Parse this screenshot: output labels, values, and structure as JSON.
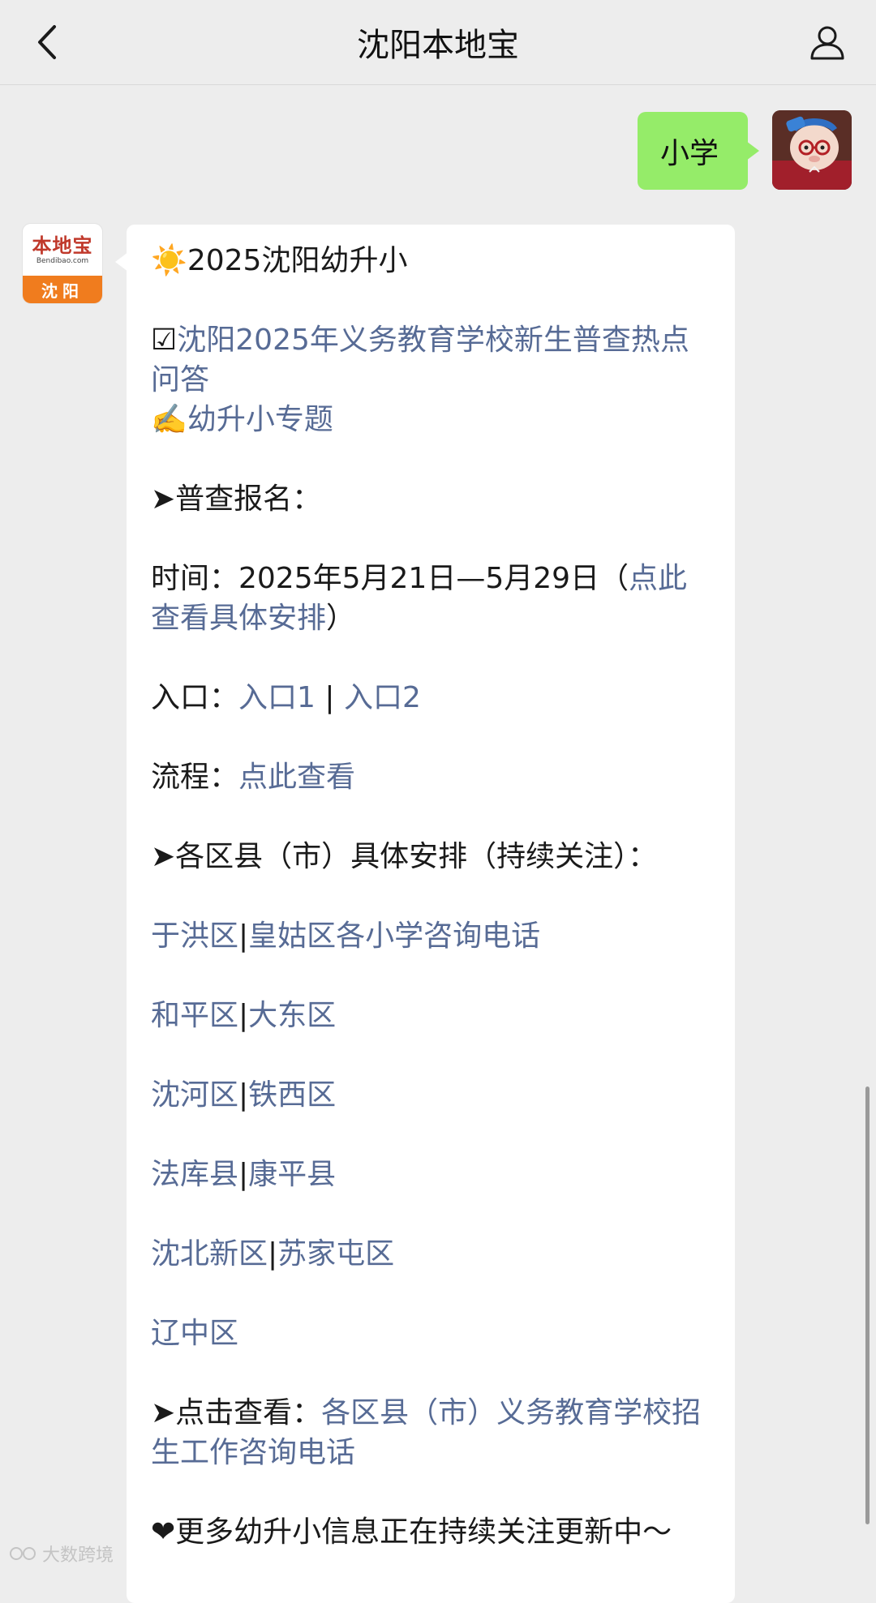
{
  "header": {
    "title": "沈阳本地宝",
    "back_icon": "chevron-left-icon",
    "profile_icon": "person-icon"
  },
  "user_message": {
    "text": "小学"
  },
  "bot": {
    "avatar": {
      "logo_text": "本地宝",
      "logo_sub": "Bendibao.com",
      "city": "沈阳"
    }
  },
  "message": {
    "heading": "2025沈阳幼升小",
    "heading_emoji": "☀️",
    "link_faq_prefix": "☑",
    "link_faq": "沈阳2025年义务教育学校新生普查热点问答",
    "link_topic_prefix": "✍️",
    "link_topic": "幼升小专题",
    "section_census": "➤普查报名：",
    "time_label": "时间：2025年5月21日—5月29日（",
    "time_link": "点此查看具体安排",
    "time_close": "）",
    "entry_label": "入口：",
    "entry_link_1": "入口1",
    "entry_sep": " | ",
    "entry_link_2": "入口2",
    "flow_label": "流程：",
    "flow_link": "点此查看",
    "section_districts": "➤各区县（市）具体安排（持续关注）：",
    "districts": [
      {
        "a": "于洪区",
        "b": "皇姑区各小学咨询电话"
      },
      {
        "a": "和平区",
        "b": "大东区"
      },
      {
        "a": "沈河区",
        "b": "铁西区"
      },
      {
        "a": "法库县",
        "b": "康平县"
      },
      {
        "a": "沈北新区",
        "b": "苏家屯区"
      }
    ],
    "district_sep": "|",
    "district_last": "辽中区",
    "click_label": "➤点击查看：",
    "click_link": "各区县（市）义务教育学校招生工作咨询电话",
    "footer": "❤更多幼升小信息正在持续关注更新中～"
  },
  "watermark": "大数跨境",
  "colors": {
    "link": "#576b95",
    "user_bubble": "#95ec69",
    "background": "#ededed",
    "brand_orange": "#f07c1e"
  }
}
